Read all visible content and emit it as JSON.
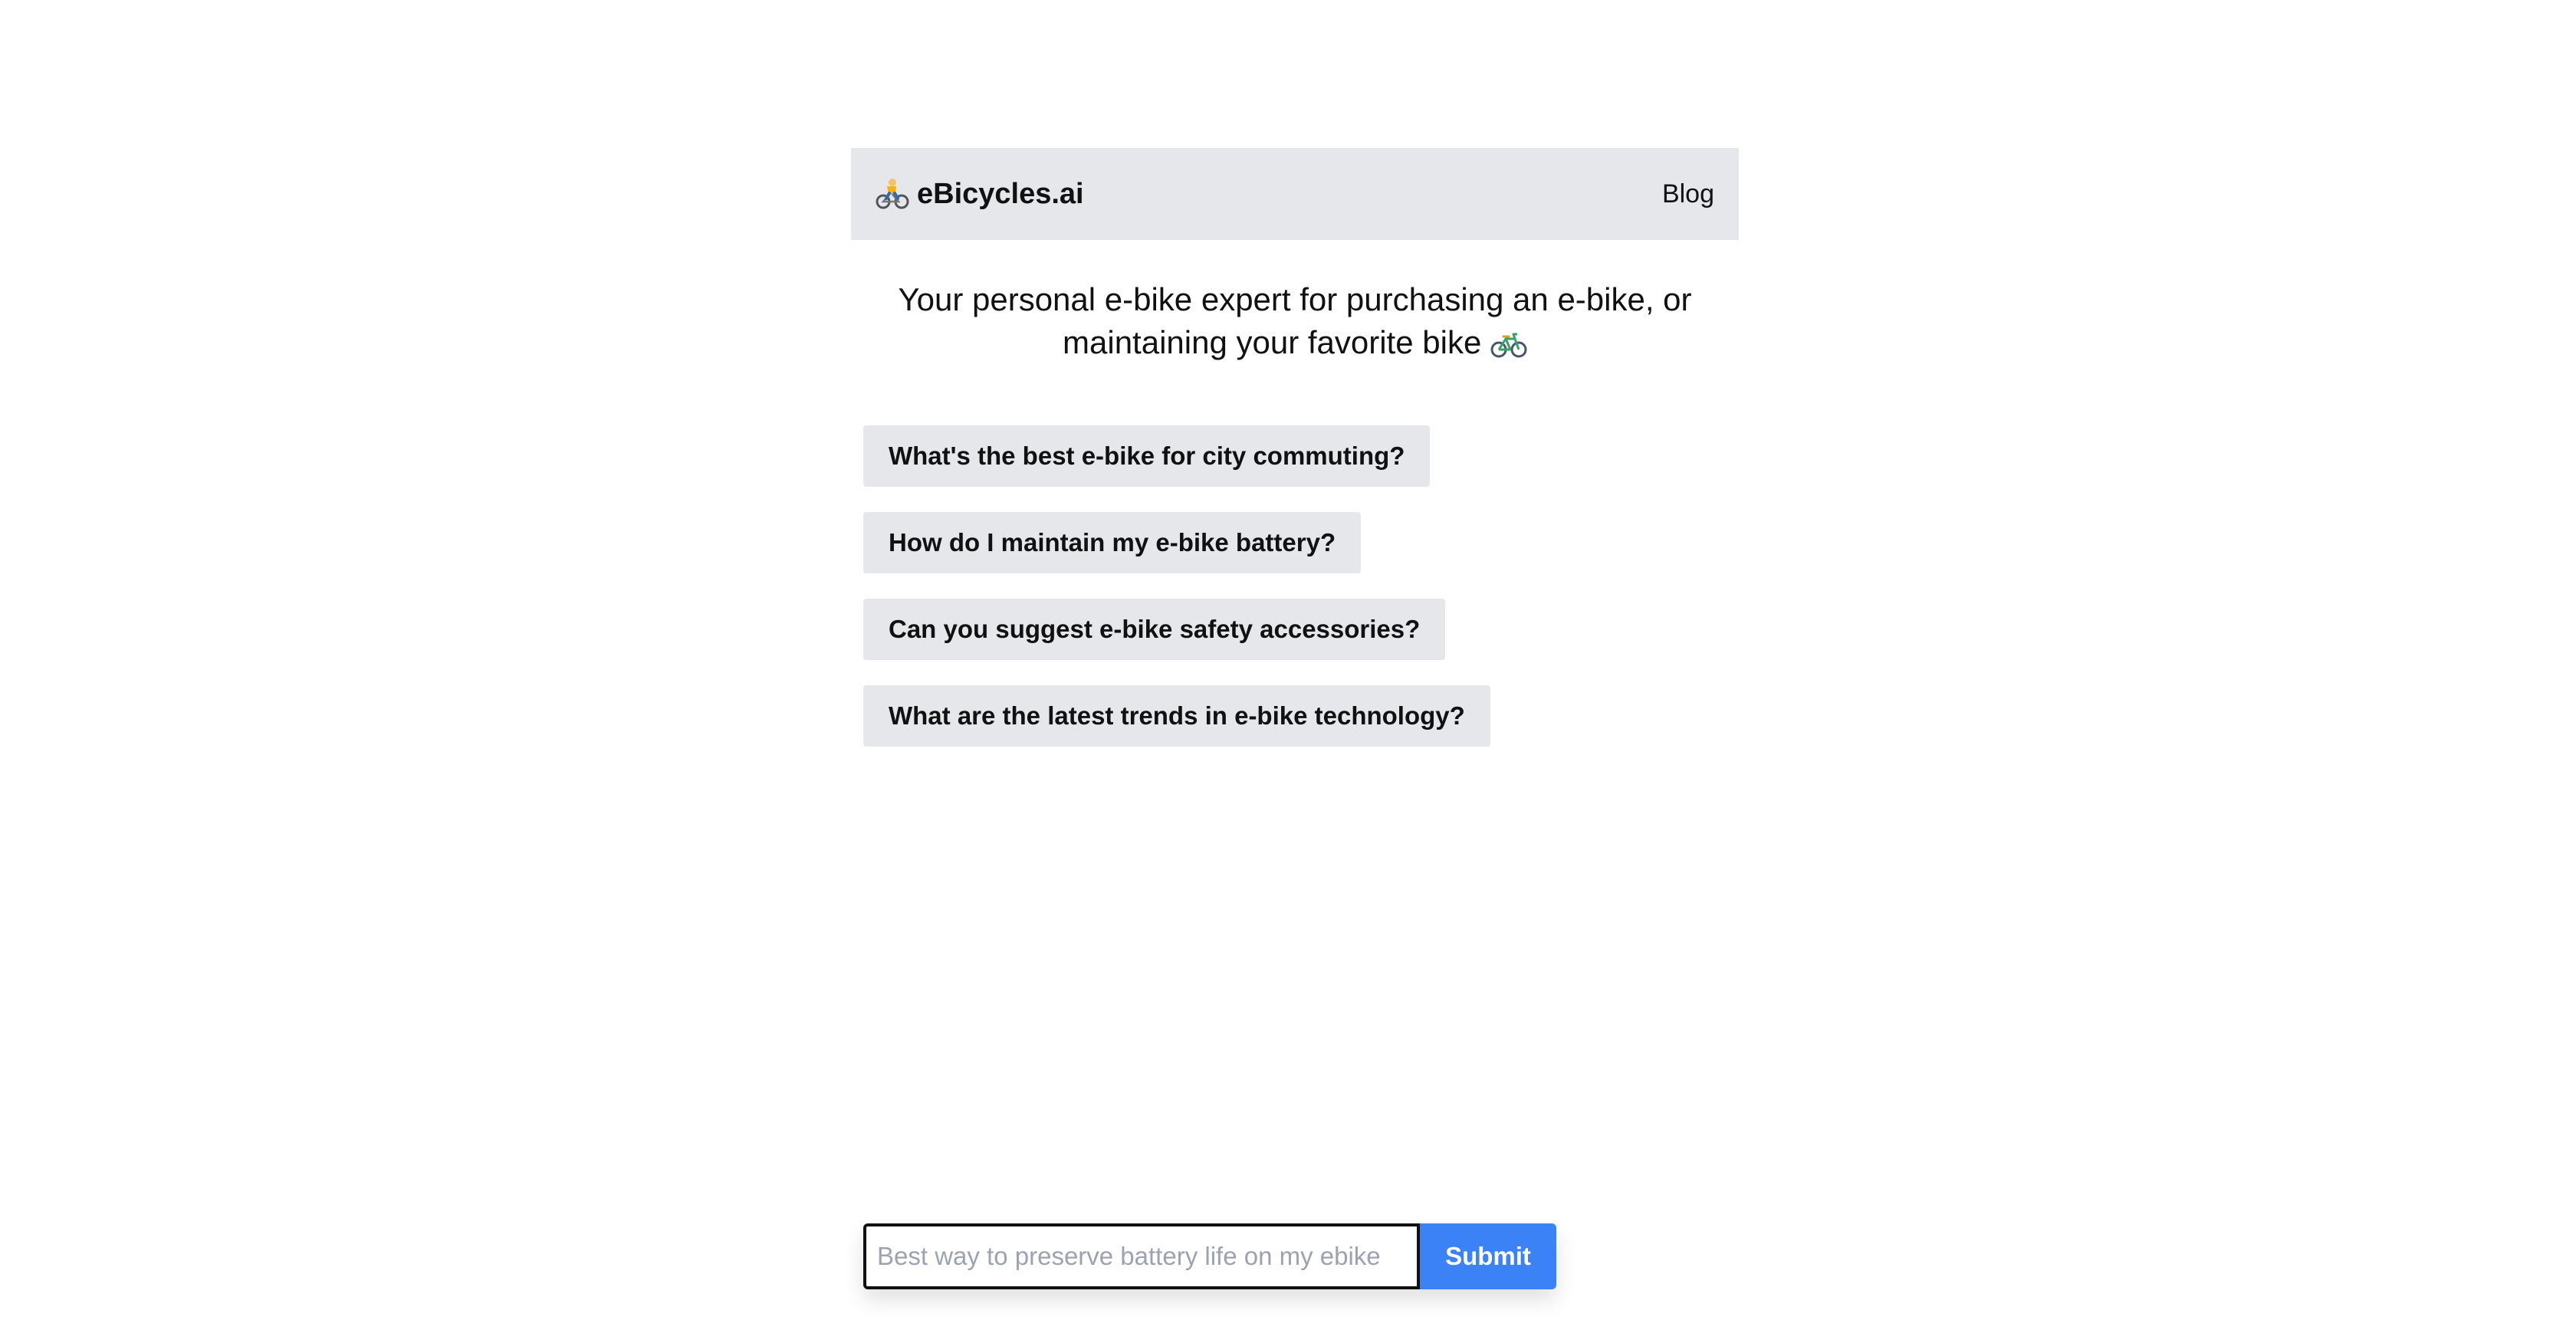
{
  "header": {
    "brand_name": "eBicycles.ai",
    "brand_icon": "person-biking-icon",
    "nav_blog": "Blog"
  },
  "tagline": {
    "text": "Your personal e-bike expert for purchasing an e-bike, or maintaining your favorite bike",
    "emoji_icon": "bicycle-icon"
  },
  "suggestions": [
    "What's the best e-bike for city commuting?",
    "How do I maintain my e-bike battery?",
    "Can you suggest e-bike safety accessories?",
    "What are the latest trends in e-bike technology?"
  ],
  "query": {
    "placeholder": "Best way to preserve battery life on my ebike",
    "value": "",
    "submit_label": "Submit"
  },
  "colors": {
    "header_bg": "#e5e7eb",
    "chip_bg": "#e5e7eb",
    "accent": "#3b82f6"
  }
}
